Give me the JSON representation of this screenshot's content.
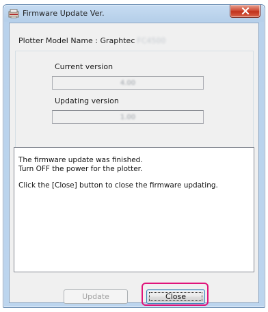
{
  "window": {
    "title": "Firmware Update Ver.",
    "app_icon": "plotter-app-icon",
    "close_icon": "close-icon",
    "titlebar_close_color": "#c8402a"
  },
  "model": {
    "label": "Plotter Model Name : Graphtec",
    "value_blurred": "FC4500"
  },
  "versions": {
    "current_label": "Current version",
    "current_value": "4.00",
    "updating_label": "Updating version",
    "updating_value": "1.00"
  },
  "message": {
    "line1": "The firmware update was finished.",
    "line2": "Turn OFF the power for the plotter.",
    "line3": "Click the [Close] button to close the firmware updating."
  },
  "buttons": {
    "update_label": "Update",
    "update_enabled": false,
    "close_label": "Close"
  },
  "annotation": {
    "highlight_color": "#e0147a"
  }
}
